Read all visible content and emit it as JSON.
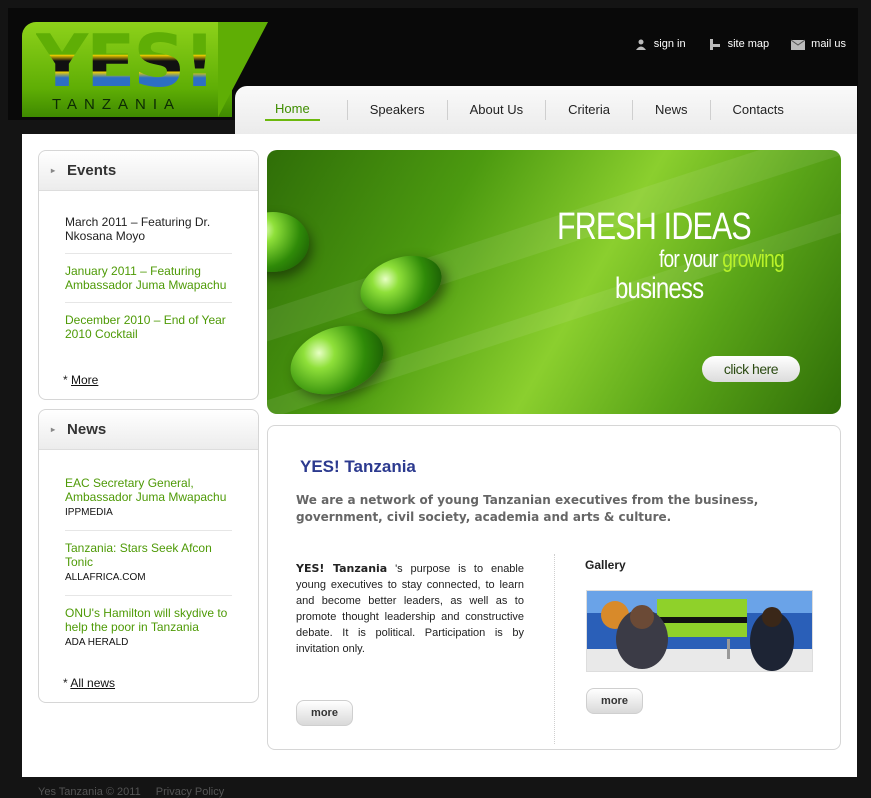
{
  "logo": {
    "text": "YES!",
    "subtitle": "TANZANIA"
  },
  "toplinks": [
    {
      "label": "sign in",
      "icon": "person-icon"
    },
    {
      "label": "site map",
      "icon": "sitemap-icon"
    },
    {
      "label": "mail us",
      "icon": "mail-icon"
    }
  ],
  "nav": {
    "home": "Home",
    "items": [
      "Speakers",
      "About Us",
      "Criteria",
      "News",
      "Contacts"
    ]
  },
  "events": {
    "title": "Events",
    "items": [
      "March 2011 – Featuring Dr. Nkosana Moyo",
      "January 2011 – Featuring Ambassador Juma Mwapachu",
      "December 2010 – End of Year 2010 Cocktail"
    ],
    "more_prefix": "* ",
    "more_label": "More"
  },
  "news": {
    "title": "News",
    "items": [
      {
        "headline": "EAC Secretary General, Ambassador Juma Mwapachu",
        "source": "IPPMEDIA"
      },
      {
        "headline": "Tanzania: Stars Seek Afcon Tonic",
        "source": "ALLAFRICA.COM"
      },
      {
        "headline": "ONU's Hamilton will skydive to help the poor in Tanzania",
        "source": "ADA HERALD"
      }
    ],
    "more_prefix": "* ",
    "more_label": "All news"
  },
  "banner": {
    "line1": "FRESH IDEAS",
    "line2a": "for your ",
    "line2b": "growing",
    "line3": "business",
    "cta": "click here"
  },
  "content": {
    "title": "YES! Tanzania",
    "intro": "We are a network of young Tanzanian executives from the business, government, civil society, academia and arts & culture.",
    "body_bold": "YES! Tanzania",
    "body_rest": " 's purpose is to enable young executives to stay connected, to learn and become better leaders, as well as to promote thought leadership and constructive debate. It is political. Participation is by invitation only.",
    "more1": "more",
    "gallery_title": "Gallery",
    "more2": "more"
  },
  "footer": {
    "copyright": "Yes Tanzania © 2011",
    "privacy": "Privacy Policy"
  },
  "colors": {
    "accent_green": "#4e9a06",
    "title_blue": "#2c3a8f",
    "background": "#141414"
  }
}
